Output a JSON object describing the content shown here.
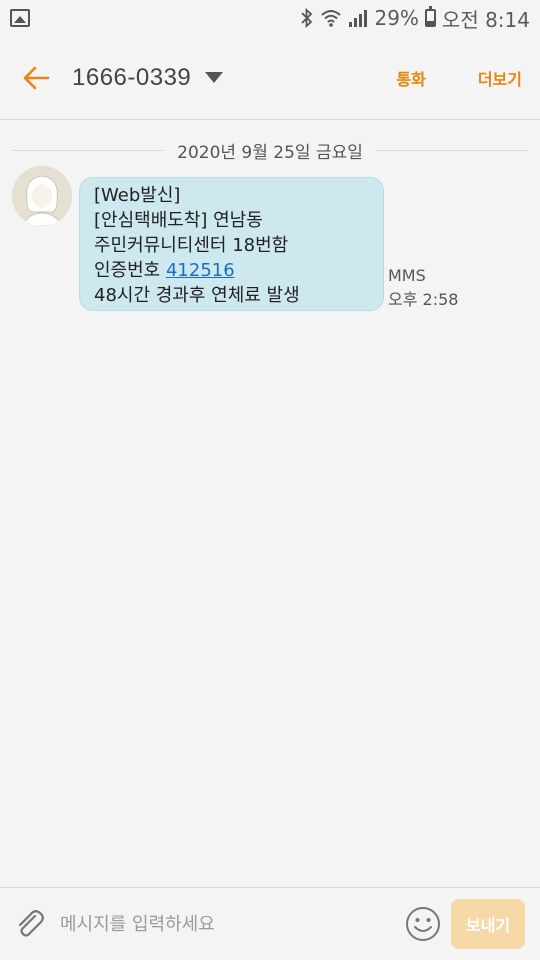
{
  "status_bar": {
    "gallery_icon": "gallery-icon",
    "bluetooth_icon": "bluetooth-icon",
    "wifi_icon": "wifi-icon",
    "signal_icon": "signal-icon",
    "battery_percent": "29%",
    "battery_icon": "battery-icon",
    "time": "오전 8:14"
  },
  "app_bar": {
    "back_icon": "arrow-left-icon",
    "contact": "1666-0339",
    "dropdown_icon": "chevron-down-icon",
    "call_label": "통화",
    "more_label": "더보기",
    "accent_color": "#e8850a"
  },
  "conversation": {
    "date": "2020년 9월 25일 금요일",
    "messages": [
      {
        "avatar": "person-avatar",
        "lines": [
          "[Web발신]",
          "[안심택배도착] 연남동",
          "주민커뮤니티센터 18번함",
          "인증번호 ",
          "48시간 경과후 연체료 발생"
        ],
        "code": "412516",
        "type": "MMS",
        "time": "오후 2:58",
        "bubble_color": "#cde8ee"
      }
    ]
  },
  "input_bar": {
    "attach_icon": "paperclip-icon",
    "placeholder": "메시지를 입력하세요",
    "value": "",
    "emoji_icon": "smiley-icon",
    "send_label": "보내기"
  }
}
